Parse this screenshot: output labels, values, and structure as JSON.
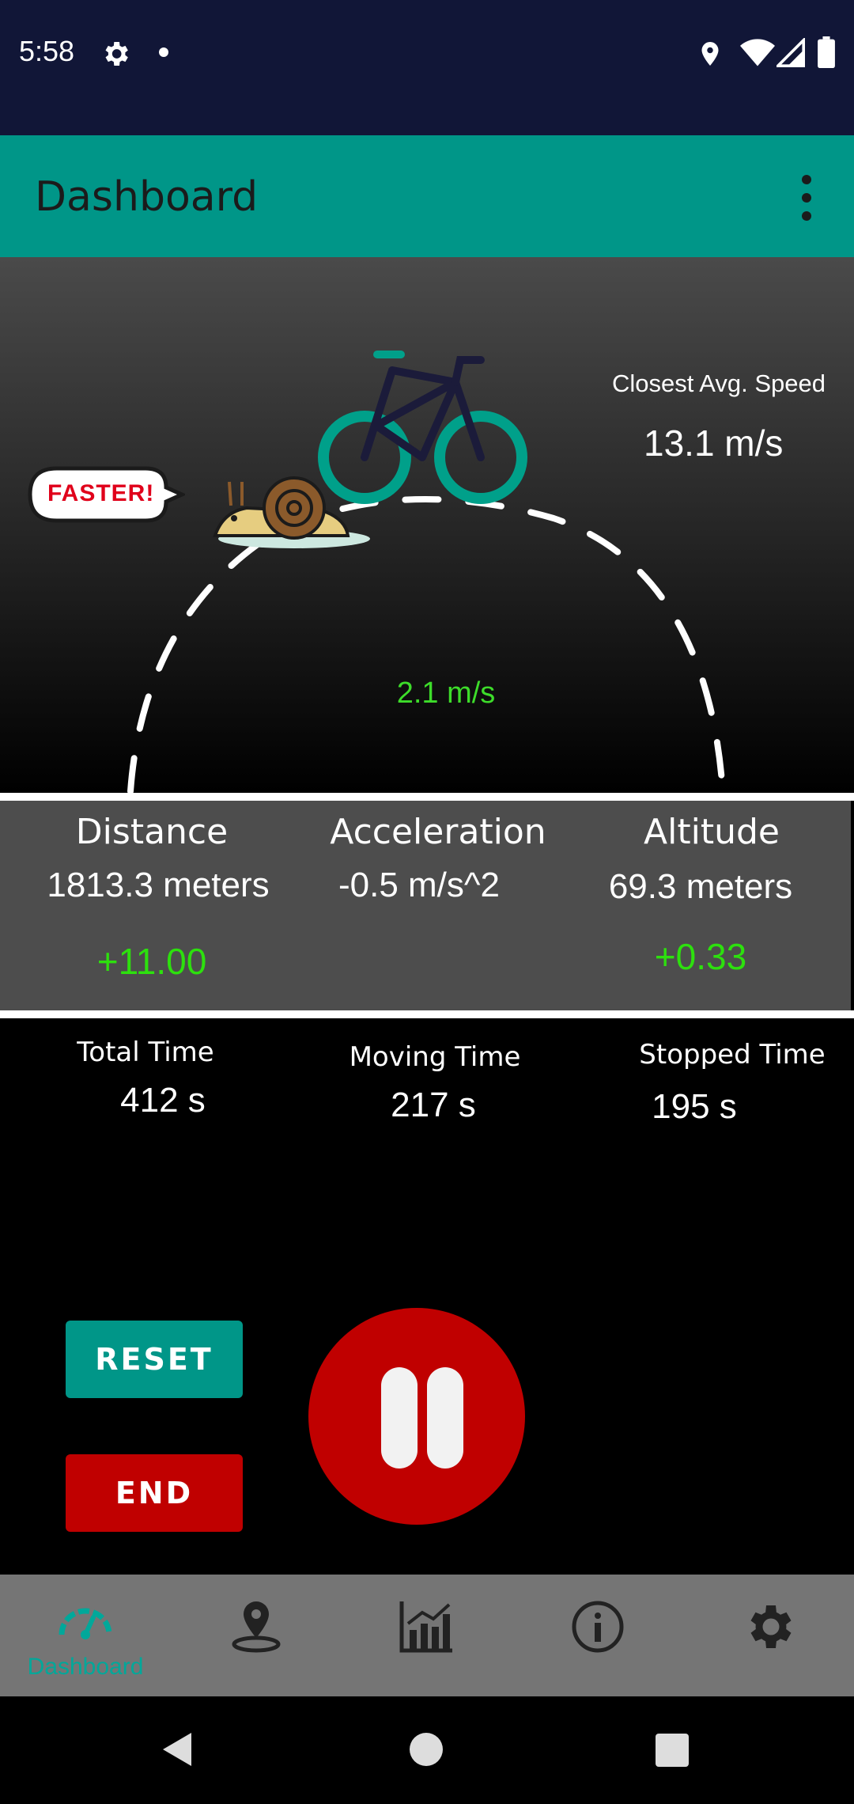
{
  "status_bar": {
    "time": "5:58",
    "icons": [
      "settings-icon",
      "notification-dot-icon",
      "location-icon",
      "wifi-icon",
      "signal-icon",
      "battery-icon"
    ]
  },
  "app_bar": {
    "title": "Dashboard",
    "menu_icon": "more-vert-icon"
  },
  "speed_panel": {
    "closest_avg_label": "Closest Avg. Speed",
    "closest_avg_value": "13.1 m/s",
    "current_speed": "2.1 m/s",
    "bubble_text": "FASTER!",
    "colors": {
      "accent": "#009688",
      "speed_green": "#3ddc2a"
    }
  },
  "stats": {
    "distance": {
      "title": "Distance",
      "value": "1813.3 meters",
      "delta": "+11.00"
    },
    "acceleration": {
      "title": "Acceleration",
      "value": "-0.5 m/s^2"
    },
    "altitude": {
      "title": "Altitude",
      "value": "69.3 meters",
      "delta": "+0.33"
    }
  },
  "times": {
    "total": {
      "label": "Total Time",
      "value": "412 s"
    },
    "moving": {
      "label": "Moving Time",
      "value": "217 s"
    },
    "stopped": {
      "label": "Stopped Time",
      "value": "195 s"
    }
  },
  "controls": {
    "reset_label": "RESET",
    "end_label": "END",
    "pause_icon": "pause-icon"
  },
  "bottom_nav": {
    "items": [
      {
        "label": "Dashboard",
        "icon": "speedometer-icon",
        "active": true
      },
      {
        "label": "",
        "icon": "map-pin-icon",
        "active": false
      },
      {
        "label": "",
        "icon": "chart-icon",
        "active": false
      },
      {
        "label": "",
        "icon": "info-icon",
        "active": false
      },
      {
        "label": "",
        "icon": "gear-icon",
        "active": false
      }
    ]
  }
}
